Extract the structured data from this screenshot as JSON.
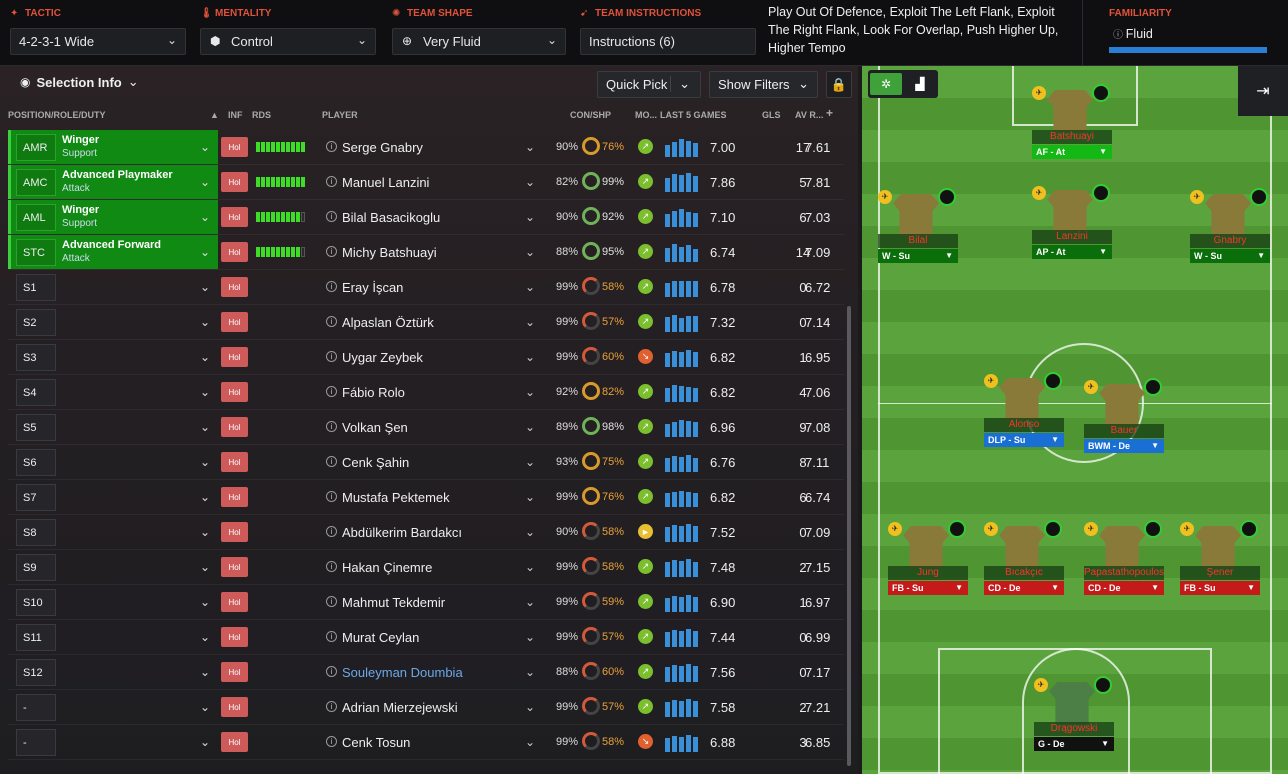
{
  "topbar": {
    "tactic": {
      "label": "TACTIC",
      "value": "4-2-3-1 Wide"
    },
    "mentality": {
      "label": "MENTALITY",
      "value": "Control"
    },
    "shape": {
      "label": "TEAM SHAPE",
      "value": "Very Fluid"
    },
    "instructions": {
      "label": "TEAM INSTRUCTIONS",
      "value": "Instructions (6)"
    },
    "instructions_text": "Play Out Of Defence, Exploit The Left Flank, Exploit The Right Flank, Look For Overlap, Push Higher Up, Higher Tempo",
    "familiarity": {
      "label": "FAMILIARITY",
      "value": "Fluid"
    }
  },
  "toolbar": {
    "selection_info": "Selection Info",
    "quick_pick": "Quick Pick",
    "show_filters": "Show Filters"
  },
  "headers": {
    "position": "POSITION/ROLE/DUTY",
    "inf": "INF",
    "rds": "RDS",
    "player": "PLAYER",
    "con": "CON/SHP",
    "mo": "MO...",
    "last5": "LAST 5 GAMES",
    "gls": "GLS",
    "avr": "AV R..."
  },
  "rows": [
    {
      "pos": "AMR",
      "role": "Winger",
      "duty": "Support",
      "starter": true,
      "rds": 10,
      "name": "Serge Gnabry",
      "con": "90%",
      "shp": "76%",
      "ring": "o",
      "mo": "up",
      "avg": "7.00",
      "gls": "17",
      "avr": "7.61",
      "l5": [
        12,
        15,
        18,
        16,
        14
      ]
    },
    {
      "pos": "AMC",
      "role": "Advanced Playmaker",
      "duty": "Attack",
      "starter": true,
      "rds": 10,
      "name": "Manuel Lanzini",
      "con": "82%",
      "shp": "99%",
      "ring": "g",
      "mo": "up",
      "avg": "7.86",
      "gls": "5",
      "avr": "7.81",
      "l5": [
        14,
        18,
        17,
        19,
        16
      ]
    },
    {
      "pos": "AML",
      "role": "Winger",
      "duty": "Support",
      "starter": true,
      "rds": 9,
      "name": "Bilal Basacikoglu",
      "con": "90%",
      "shp": "92%",
      "ring": "g",
      "mo": "up",
      "avg": "7.10",
      "gls": "6",
      "avr": "7.03",
      "l5": [
        13,
        16,
        18,
        15,
        14
      ]
    },
    {
      "pos": "STC",
      "role": "Advanced Forward",
      "duty": "Attack",
      "starter": true,
      "rds": 9,
      "name": "Michy Batshuayi",
      "con": "88%",
      "shp": "95%",
      "ring": "g",
      "mo": "up",
      "avg": "6.74",
      "gls": "14",
      "avr": "7.09",
      "l5": [
        14,
        18,
        15,
        17,
        13
      ]
    },
    {
      "pos": "S1",
      "role": "",
      "duty": "",
      "starter": false,
      "rds": 0,
      "name": "Eray İşcan",
      "con": "99%",
      "shp": "58%",
      "ring": "r",
      "mo": "up",
      "avg": "6.78",
      "gls": "0",
      "avr": "6.72",
      "l5": [
        14,
        16,
        16,
        16,
        16
      ]
    },
    {
      "pos": "S2",
      "role": "",
      "duty": "",
      "starter": false,
      "rds": 0,
      "name": "Alpaslan Öztürk",
      "con": "99%",
      "shp": "57%",
      "ring": "r",
      "mo": "up",
      "avg": "7.32",
      "gls": "0",
      "avr": "7.14",
      "l5": [
        15,
        17,
        14,
        16,
        16
      ]
    },
    {
      "pos": "S3",
      "role": "",
      "duty": "",
      "starter": false,
      "rds": 0,
      "name": "Uygar Zeybek",
      "con": "99%",
      "shp": "60%",
      "ring": "r",
      "mo": "down",
      "avg": "6.82",
      "gls": "1",
      "avr": "6.95",
      "l5": [
        14,
        16,
        15,
        17,
        15
      ]
    },
    {
      "pos": "S4",
      "role": "",
      "duty": "",
      "starter": false,
      "rds": 0,
      "name": "Fábio Rolo",
      "con": "92%",
      "shp": "82%",
      "ring": "o",
      "mo": "up",
      "avg": "6.82",
      "gls": "4",
      "avr": "7.06",
      "l5": [
        14,
        17,
        16,
        15,
        14
      ]
    },
    {
      "pos": "S5",
      "role": "",
      "duty": "",
      "starter": false,
      "rds": 0,
      "name": "Volkan Şen",
      "con": "89%",
      "shp": "98%",
      "ring": "g",
      "mo": "up",
      "avg": "6.96",
      "gls": "9",
      "avr": "7.08",
      "l5": [
        13,
        15,
        17,
        16,
        15
      ]
    },
    {
      "pos": "S6",
      "role": "",
      "duty": "",
      "starter": false,
      "rds": 0,
      "name": "Cenk Şahin",
      "con": "93%",
      "shp": "75%",
      "ring": "o",
      "mo": "up",
      "avg": "6.76",
      "gls": "8",
      "avr": "7.11",
      "l5": [
        14,
        16,
        15,
        17,
        14
      ]
    },
    {
      "pos": "S7",
      "role": "",
      "duty": "",
      "starter": false,
      "rds": 0,
      "name": "Mustafa Pektemek",
      "con": "99%",
      "shp": "76%",
      "ring": "o",
      "mo": "up",
      "avg": "6.82",
      "gls": "6",
      "avr": "6.74",
      "l5": [
        14,
        15,
        16,
        15,
        14
      ]
    },
    {
      "pos": "S8",
      "role": "",
      "duty": "",
      "starter": false,
      "rds": 0,
      "name": "Abdülkerim Bardakcı",
      "con": "90%",
      "shp": "58%",
      "ring": "r",
      "mo": "flat",
      "avg": "7.52",
      "gls": "0",
      "avr": "7.09",
      "l5": [
        15,
        17,
        16,
        18,
        16
      ]
    },
    {
      "pos": "S9",
      "role": "",
      "duty": "",
      "starter": false,
      "rds": 0,
      "name": "Hakan Çinemre",
      "con": "99%",
      "shp": "58%",
      "ring": "r",
      "mo": "up",
      "avg": "7.48",
      "gls": "2",
      "avr": "7.15",
      "l5": [
        15,
        17,
        16,
        18,
        15
      ]
    },
    {
      "pos": "S10",
      "role": "",
      "duty": "",
      "starter": false,
      "rds": 0,
      "name": "Mahmut Tekdemir",
      "con": "99%",
      "shp": "59%",
      "ring": "r",
      "mo": "up",
      "avg": "6.90",
      "gls": "1",
      "avr": "6.97",
      "l5": [
        14,
        16,
        15,
        17,
        15
      ]
    },
    {
      "pos": "S11",
      "role": "",
      "duty": "",
      "starter": false,
      "rds": 0,
      "name": "Murat Ceylan",
      "con": "99%",
      "shp": "57%",
      "ring": "r",
      "mo": "up",
      "avg": "7.44",
      "gls": "0",
      "avr": "6.99",
      "l5": [
        15,
        17,
        16,
        18,
        16
      ]
    },
    {
      "pos": "S12",
      "role": "",
      "duty": "",
      "starter": false,
      "rds": 0,
      "name": "Souleyman Doumbia",
      "link": true,
      "con": "88%",
      "shp": "60%",
      "ring": "r",
      "mo": "up",
      "avg": "7.56",
      "gls": "0",
      "avr": "7.17",
      "l5": [
        15,
        17,
        16,
        18,
        16
      ]
    },
    {
      "pos": "-",
      "role": "",
      "duty": "",
      "starter": false,
      "rds": 0,
      "name": "Adrian Mierzejewski",
      "con": "99%",
      "shp": "57%",
      "ring": "r",
      "mo": "up",
      "avg": "7.58",
      "gls": "2",
      "avr": "7.21",
      "l5": [
        15,
        17,
        16,
        18,
        16
      ]
    },
    {
      "pos": "-",
      "role": "",
      "duty": "",
      "starter": false,
      "rds": 0,
      "name": "Cenk Tosun",
      "con": "99%",
      "shp": "58%",
      "ring": "r",
      "mo": "down",
      "avg": "6.88",
      "gls": "3",
      "avr": "6.85",
      "l5": [
        14,
        16,
        15,
        17,
        15
      ]
    }
  ],
  "pitch_players": [
    {
      "name": "Batshuayi",
      "role": "AF - At",
      "color": "#14b814"
    },
    {
      "name": "Bilal",
      "role": "W - Su",
      "color": "#0a6e0a"
    },
    {
      "name": "Lanzini",
      "role": "AP - At",
      "color": "#0a6e0a"
    },
    {
      "name": "Gnabry",
      "role": "W - Su",
      "color": "#0a6e0a"
    },
    {
      "name": "Alonso",
      "role": "DLP - Su",
      "color": "#1a6fd4"
    },
    {
      "name": "Bauer",
      "role": "BWM - De",
      "color": "#1a6fd4"
    },
    {
      "name": "Jung",
      "role": "FB - Su",
      "color": "#c41a1a"
    },
    {
      "name": "Bıcakçıc",
      "role": "CD - De",
      "color": "#c41a1a"
    },
    {
      "name": "Papastathopoulos",
      "role": "CD - De",
      "color": "#c41a1a"
    },
    {
      "name": "Şener",
      "role": "FB - Su",
      "color": "#c41a1a"
    },
    {
      "name": "Drągowski",
      "role": "G - De",
      "color": "#111111"
    }
  ]
}
